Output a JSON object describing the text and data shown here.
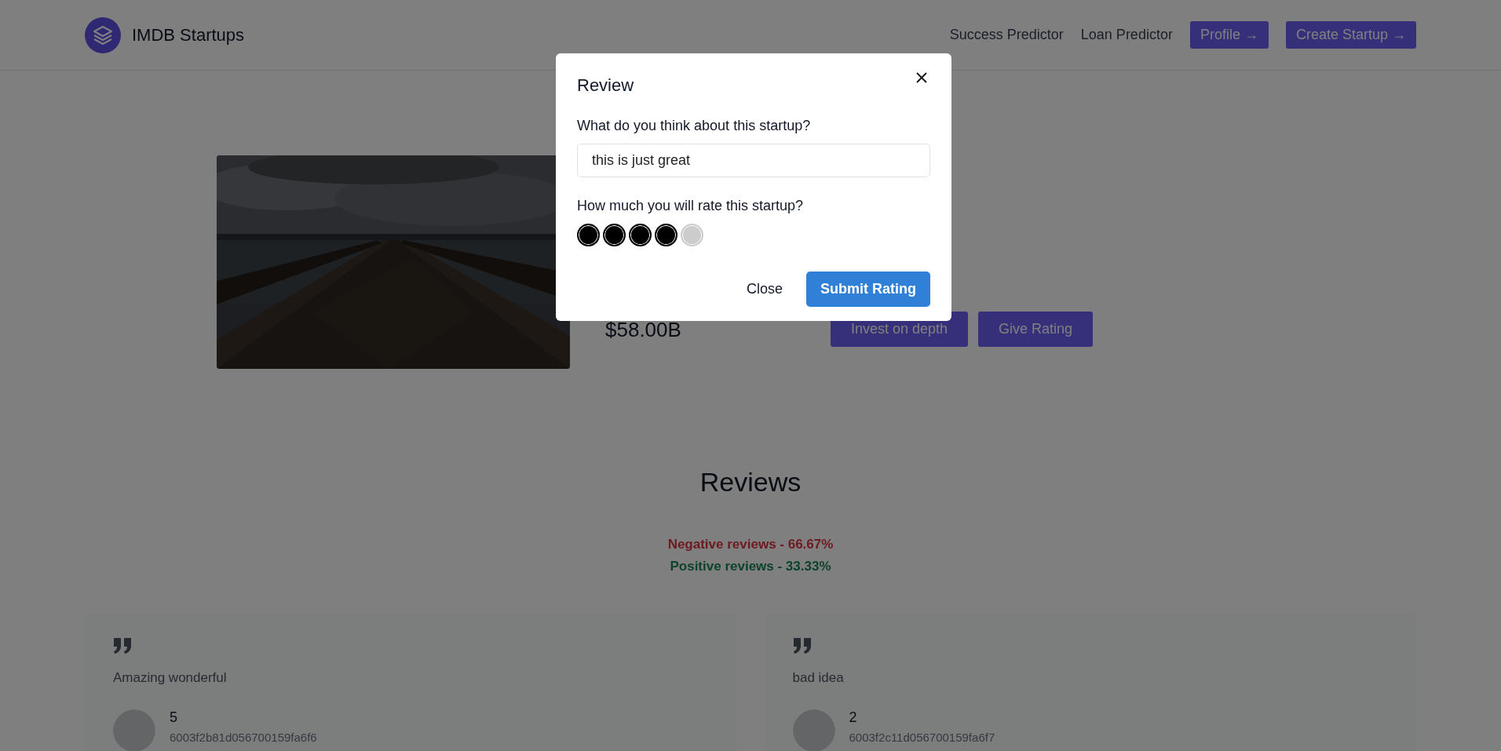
{
  "header": {
    "brand": "IMDB Startups",
    "nav_links": [
      "Success Predictor",
      "Loan Predictor"
    ],
    "nav_buttons": [
      "Profile →",
      "Create Startup →"
    ]
  },
  "startup": {
    "valuation": "$58.00B",
    "actions": [
      "Invest on depth",
      "Give Rating"
    ]
  },
  "reviews": {
    "title": "Reviews",
    "negative": "Negative reviews - 66.67%",
    "positive": "Positive reviews - 33.33%",
    "items": [
      {
        "text": "Amazing wonderful",
        "rating": "5",
        "user_id": "6003f2b81d056700159fa6f6"
      },
      {
        "text": "bad idea",
        "rating": "2",
        "user_id": "6003f2c11d056700159fa6f7"
      }
    ]
  },
  "modal": {
    "title": "Review",
    "question": "What do you think about this startup?",
    "answer": "this is just great",
    "rating_label": "How much you will rate this startup?",
    "rating": {
      "stars": 4
    },
    "buttons": [
      {
        "label": "Close",
        "kind": "plain"
      },
      {
        "label": "Submit Rating",
        "kind": "primary"
      }
    ]
  }
}
